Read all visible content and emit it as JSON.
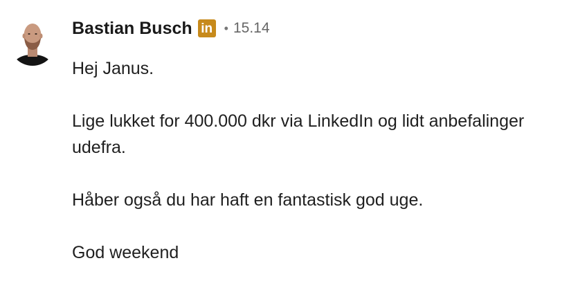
{
  "message": {
    "sender_name": "Bastian Busch",
    "badge_text": "in",
    "separator": "•",
    "timestamp": "15.14",
    "paragraphs": [
      "Hej Janus.",
      "Lige lukket for 400.000 dkr via LinkedIn og lidt anbefalinger udefra.",
      "Håber også du har haft en fantastisk god uge.",
      "God weekend"
    ]
  },
  "colors": {
    "badge": "#c78a1b",
    "name": "#1a1a1a",
    "timestamp": "#666666",
    "body_text": "#1f1f1f"
  },
  "icons": {
    "avatar": "profile-photo",
    "badge": "linkedin-premium-icon"
  }
}
